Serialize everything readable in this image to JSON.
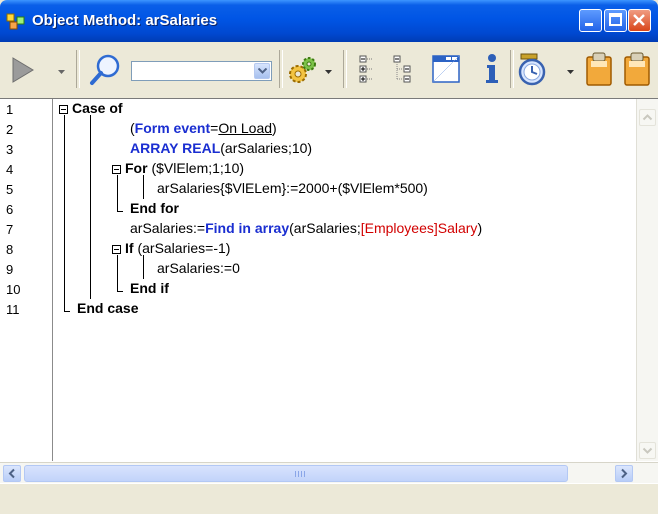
{
  "window": {
    "title": "Object Method: arSalaries"
  },
  "toolbar": {
    "search_value": ""
  },
  "editor": {
    "line_numbers": [
      "1",
      "2",
      "3",
      "4",
      "5",
      "6",
      "7",
      "8",
      "9",
      "10",
      "11"
    ],
    "lines": {
      "l1": {
        "kw": "Case of"
      },
      "l2": {
        "open": "(",
        "cmd": "Form event",
        "eq": "=",
        "const": "On Load",
        "close": ")"
      },
      "l3": {
        "cmd": "ARRAY REAL",
        "args": "(arSalaries;10)"
      },
      "l4": {
        "kw": "For",
        "args": " ($VlElem;1;10)"
      },
      "l5": {
        "text": "arSalaries{$VlELem}:=2000+($VlElem*500)"
      },
      "l6": {
        "kw": "End for"
      },
      "l7": {
        "pre": "arSalaries:=",
        "cmd": "Find in array",
        "mid": "(arSalaries;",
        "field": "[Employees]Salary",
        "post": ")"
      },
      "l8": {
        "kw": "If",
        "args": " (arSalaries=-1)"
      },
      "l9": {
        "text": "arSalaries:=0"
      },
      "l10": {
        "kw": "End if"
      },
      "l11": {
        "kw": "End case"
      }
    }
  },
  "hscroll": {
    "grip": "|||"
  },
  "icons": {
    "title": "4d-method-icon",
    "run": "run-triangle-icon",
    "search": "magnifier-icon",
    "gears": "gears-icon",
    "collapse": "collapse-all-icon",
    "expand": "expand-tree-icon",
    "form": "form-icon",
    "info": "info-icon",
    "clock": "clock-icon",
    "clip1": "clipboard-icon",
    "clip2": "clipboard-icon"
  }
}
